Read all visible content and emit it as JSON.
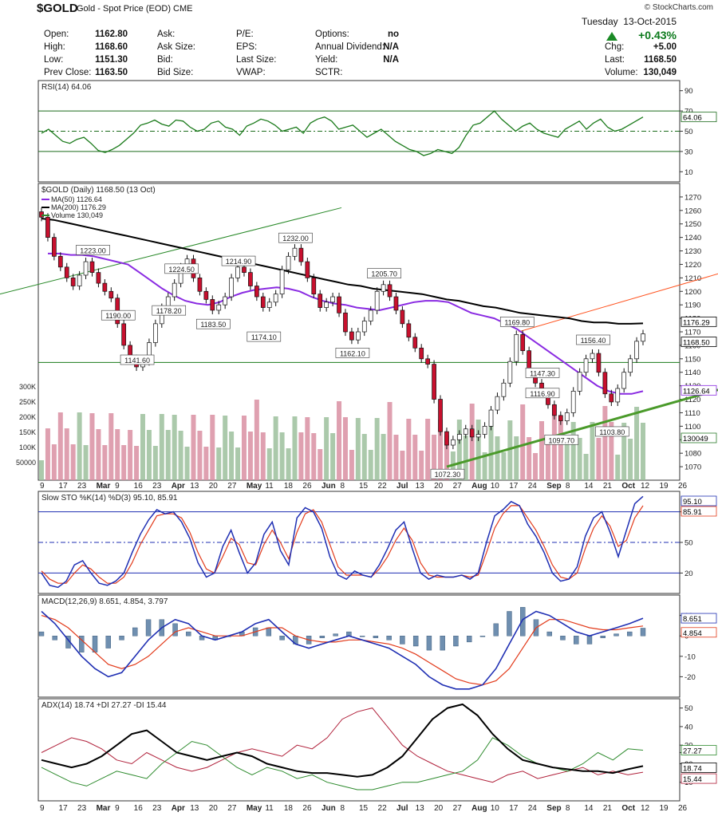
{
  "header": {
    "symbol": "$GOLD",
    "name": "Gold - Spot Price (EOD)",
    "exchange": "CME",
    "credit": "© StockCharts.com",
    "day": "Tuesday",
    "date": "13-Oct-2015",
    "change_pct": "+0.43%",
    "quote": [
      {
        "label": "Open:",
        "value": "1162.80"
      },
      {
        "label": "High:",
        "value": "1168.60"
      },
      {
        "label": "Low:",
        "value": "1151.30"
      },
      {
        "label": "Prev Close:",
        "value": "1163.50"
      }
    ],
    "quote2": [
      {
        "label": "Ask:",
        "value": ""
      },
      {
        "label": "Ask Size:",
        "value": ""
      },
      {
        "label": "Bid:",
        "value": ""
      },
      {
        "label": "Bid Size:",
        "value": ""
      }
    ],
    "quote3": [
      {
        "label": "P/E:",
        "value": ""
      },
      {
        "label": "EPS:",
        "value": ""
      },
      {
        "label": "Last Size:",
        "value": ""
      },
      {
        "label": "VWAP:",
        "value": ""
      }
    ],
    "quote4": [
      {
        "label": "Options:",
        "value": "no"
      },
      {
        "label": "Annual Dividend:",
        "value": "N/A"
      },
      {
        "label": "Yield:",
        "value": "N/A"
      },
      {
        "label": "SCTR:",
        "value": ""
      }
    ],
    "quote5": [
      {
        "label": "Chg:",
        "value": "+5.00"
      },
      {
        "label": "Last:",
        "value": "1168.50"
      },
      {
        "label": "Volume:",
        "value": "130,049"
      }
    ]
  },
  "chart_data": [
    {
      "type": "line",
      "title": "RSI(14) 64.06",
      "ylim": [
        0,
        100
      ],
      "yticks": [
        10,
        30,
        50,
        70,
        90
      ],
      "levels": [
        30,
        50,
        70
      ],
      "last_value_label": "64.06",
      "series": [
        {
          "name": "RSI(14)",
          "color": "#1a7a1a",
          "values": [
            48,
            52,
            46,
            40,
            38,
            42,
            44,
            38,
            31,
            29,
            32,
            36,
            42,
            48,
            56,
            58,
            61,
            57,
            55,
            61,
            60,
            54,
            50,
            52,
            58,
            60,
            54,
            52,
            46,
            55,
            58,
            62,
            60,
            56,
            50,
            52,
            54,
            48,
            58,
            62,
            64,
            60,
            52,
            54,
            56,
            50,
            44,
            48,
            52,
            46,
            40,
            36,
            32,
            30,
            26,
            28,
            32,
            30,
            28,
            34,
            46,
            56,
            58,
            64,
            70,
            62,
            56,
            50,
            55,
            58,
            52,
            48,
            46,
            44,
            52,
            56,
            60,
            52,
            58,
            62,
            54,
            50,
            52,
            56,
            60,
            64
          ]
        }
      ]
    },
    {
      "type": "candlestick",
      "title": "$GOLD (Daily) 1168.50 (13 Oct)",
      "ylim": [
        1060,
        1280
      ],
      "yticks": [
        1070,
        1080,
        1090,
        1100,
        1110,
        1120,
        1130,
        1140,
        1150,
        1160,
        1170,
        1180,
        1190,
        1200,
        1210,
        1220,
        1230,
        1240,
        1250,
        1260,
        1270
      ],
      "legend": [
        {
          "label": "MA(50) 1126.64",
          "color": "#8a2be2"
        },
        {
          "label": "MA(200) 1176.29",
          "color": "#000000"
        },
        {
          "label": "Volume 130,049",
          "color": "#2e8b2e"
        }
      ],
      "last_labels": [
        "1176.29",
        "1168.50",
        "1126.64",
        "130049"
      ],
      "closes": [
        1255,
        1240,
        1226,
        1218,
        1210,
        1204,
        1212,
        1222,
        1214,
        1206,
        1200,
        1195,
        1176,
        1160,
        1150,
        1144,
        1148,
        1162,
        1176,
        1188,
        1196,
        1206,
        1218,
        1224,
        1210,
        1200,
        1194,
        1186,
        1190,
        1196,
        1210,
        1218,
        1214,
        1204,
        1196,
        1188,
        1192,
        1198,
        1216,
        1226,
        1232,
        1222,
        1210,
        1198,
        1188,
        1192,
        1196,
        1184,
        1170,
        1164,
        1170,
        1178,
        1186,
        1200,
        1205,
        1196,
        1186,
        1176,
        1166,
        1158,
        1150,
        1146,
        1120,
        1096,
        1086,
        1090,
        1094,
        1098,
        1092,
        1094,
        1100,
        1112,
        1122,
        1132,
        1148,
        1168,
        1156,
        1140,
        1132,
        1124,
        1116,
        1108,
        1104,
        1110,
        1126,
        1140,
        1150,
        1154,
        1140,
        1124,
        1118,
        1128,
        1140,
        1150,
        1163,
        1168.5
      ],
      "ma50": [
        1228,
        1228,
        1227,
        1227,
        1226,
        1224,
        1222,
        1220,
        1214,
        1208,
        1202,
        1197,
        1193,
        1191,
        1190,
        1192,
        1196,
        1199,
        1201,
        1202,
        1203,
        1202,
        1200,
        1196,
        1193,
        1191,
        1190,
        1188,
        1187,
        1186,
        1188,
        1190,
        1192,
        1193,
        1193,
        1192,
        1188,
        1184,
        1182,
        1180,
        1176,
        1172,
        1166,
        1160,
        1154,
        1148,
        1142,
        1136,
        1130,
        1126,
        1124,
        1124,
        1126
      ],
      "ma200": [
        1254,
        1253,
        1251,
        1249,
        1247,
        1245,
        1243,
        1241,
        1239,
        1237,
        1235,
        1233,
        1231,
        1229,
        1227,
        1225,
        1223,
        1221,
        1219,
        1217,
        1215,
        1213,
        1211,
        1209,
        1207,
        1205,
        1204,
        1202,
        1201,
        1200,
        1199,
        1198,
        1196,
        1194,
        1193,
        1191,
        1189,
        1188,
        1186,
        1184,
        1183,
        1182,
        1181,
        1180,
        1178,
        1177,
        1177,
        1176,
        1176,
        1176.29
      ],
      "annotations": [
        "1223.00",
        "1190.00",
        "1141.60",
        "1224.50",
        "1178.20",
        "1183.50",
        "1214.90",
        "1174.10",
        "1232.00",
        "1162.10",
        "1205.70",
        "1072.30",
        "1169.80",
        "1147.30",
        "1116.90",
        "1097.70",
        "1156.40",
        "1103.80"
      ],
      "volume_ticks": [
        "50000",
        "100K",
        "150K",
        "200K",
        "250K",
        "300K"
      ],
      "x_labels": [
        "9",
        "17",
        "23",
        "Mar",
        "9",
        "16",
        "23",
        "Apr",
        "13",
        "20",
        "27",
        "May",
        "11",
        "18",
        "26",
        "Jun",
        "8",
        "15",
        "22",
        "Jul",
        "13",
        "20",
        "27",
        "Aug",
        "10",
        "17",
        "24",
        "Sep",
        "8",
        "14",
        "21",
        "Oct",
        "12",
        "19",
        "26"
      ]
    },
    {
      "type": "line",
      "title": "Slow STO %K(14) %D(3) 95.10, 85.91",
      "ylim": [
        0,
        100
      ],
      "yticks": [
        20,
        50,
        80
      ],
      "last_labels": [
        "95.10",
        "85.91"
      ],
      "series": [
        {
          "name": "%K",
          "color": "#1f2fb3",
          "values": [
            20,
            8,
            6,
            12,
            28,
            32,
            20,
            10,
            8,
            12,
            20,
            40,
            58,
            72,
            82,
            78,
            80,
            70,
            54,
            30,
            16,
            20,
            46,
            62,
            40,
            20,
            30,
            58,
            70,
            42,
            28,
            74,
            84,
            80,
            64,
            36,
            18,
            14,
            22,
            18,
            16,
            28,
            44,
            62,
            70,
            44,
            20,
            14,
            18,
            16,
            16,
            18,
            14,
            20,
            50,
            76,
            82,
            90,
            86,
            68,
            56,
            40,
            20,
            12,
            14,
            26,
            56,
            74,
            80,
            60,
            36,
            62,
            88,
            95.1
          ]
        },
        {
          "name": "%D",
          "color": "#e23a1a",
          "values": [
            22,
            14,
            10,
            10,
            20,
            28,
            24,
            16,
            10,
            10,
            16,
            30,
            48,
            62,
            76,
            78,
            78,
            74,
            60,
            40,
            24,
            20,
            36,
            54,
            48,
            30,
            28,
            48,
            62,
            50,
            34,
            60,
            78,
            82,
            70,
            48,
            26,
            18,
            18,
            18,
            16,
            24,
            36,
            52,
            64,
            52,
            30,
            18,
            16,
            16,
            16,
            18,
            16,
            18,
            40,
            64,
            78,
            86,
            86,
            74,
            62,
            46,
            28,
            16,
            14,
            20,
            44,
            64,
            76,
            66,
            46,
            52,
            74,
            85.91
          ]
        }
      ]
    },
    {
      "type": "line",
      "title": "MACD(12,26,9) 8.651, 4.854, 3.797",
      "ylim": [
        -30,
        20
      ],
      "yticks": [
        -20,
        -10,
        0,
        10
      ],
      "last_labels": [
        "8.651",
        "4.854"
      ],
      "series": [
        {
          "name": "MACD",
          "color": "#1f2fb3",
          "values": [
            12,
            6,
            -2,
            -10,
            -16,
            -20,
            -18,
            -10,
            -2,
            4,
            8,
            6,
            0,
            -2,
            0,
            2,
            6,
            8,
            2,
            -4,
            -6,
            -4,
            -2,
            0,
            -2,
            -4,
            -6,
            -10,
            -14,
            -20,
            -24,
            -26,
            -26,
            -24,
            -16,
            -4,
            8,
            12,
            10,
            6,
            2,
            0,
            2,
            4,
            6,
            8.651
          ]
        },
        {
          "name": "Signal",
          "color": "#e23a1a",
          "values": [
            10,
            8,
            4,
            -2,
            -8,
            -14,
            -16,
            -14,
            -10,
            -4,
            2,
            4,
            2,
            0,
            0,
            0,
            2,
            4,
            4,
            0,
            -2,
            -3,
            -3,
            -2,
            -2,
            -3,
            -4,
            -6,
            -9,
            -13,
            -17,
            -21,
            -23,
            -24,
            -22,
            -16,
            -6,
            4,
            8,
            8,
            6,
            4,
            3,
            3,
            4,
            4.854
          ]
        }
      ],
      "histogram": [
        2,
        -2,
        -6,
        -8,
        -8,
        -6,
        -2,
        4,
        8,
        8,
        6,
        2,
        -2,
        -2,
        0,
        2,
        4,
        4,
        -2,
        -4,
        -4,
        -1,
        1,
        2,
        0,
        -1,
        -2,
        -4,
        -5,
        -7,
        -7,
        -5,
        -3,
        0,
        6,
        12,
        14,
        8,
        2,
        -2,
        -4,
        -4,
        -1,
        1,
        2,
        3.797
      ]
    },
    {
      "type": "line",
      "title": "ADX(14) 18.74 +DI 27.27 -DI 15.44",
      "ylim": [
        0,
        55
      ],
      "yticks": [
        10,
        20,
        26,
        30,
        40,
        50
      ],
      "last_labels": [
        "27.27",
        "18.74",
        "15.44"
      ],
      "series": [
        {
          "name": "ADX(14)",
          "color": "#000000",
          "values": [
            22,
            20,
            18,
            20,
            24,
            30,
            36,
            38,
            32,
            26,
            24,
            22,
            24,
            26,
            24,
            20,
            18,
            16,
            15,
            15,
            14,
            13,
            14,
            18,
            24,
            34,
            44,
            50,
            52,
            46,
            36,
            28,
            22,
            20,
            18,
            17,
            16,
            16,
            15,
            17,
            18.74
          ]
        },
        {
          "name": "+DI",
          "color": "#2e8b2e",
          "values": [
            18,
            14,
            10,
            8,
            12,
            16,
            14,
            12,
            20,
            26,
            32,
            30,
            24,
            18,
            14,
            18,
            16,
            12,
            14,
            10,
            8,
            6,
            6,
            8,
            10,
            10,
            12,
            14,
            16,
            22,
            34,
            30,
            24,
            20,
            18,
            16,
            20,
            26,
            22,
            28,
            27.27
          ]
        },
        {
          "name": "-DI",
          "color": "#b0203a",
          "values": [
            26,
            30,
            34,
            32,
            28,
            22,
            20,
            26,
            22,
            18,
            16,
            18,
            22,
            26,
            28,
            26,
            24,
            30,
            28,
            34,
            44,
            48,
            50,
            40,
            30,
            24,
            20,
            16,
            14,
            12,
            10,
            14,
            16,
            12,
            14,
            16,
            18,
            14,
            16,
            14,
            15.44
          ]
        }
      ]
    }
  ]
}
